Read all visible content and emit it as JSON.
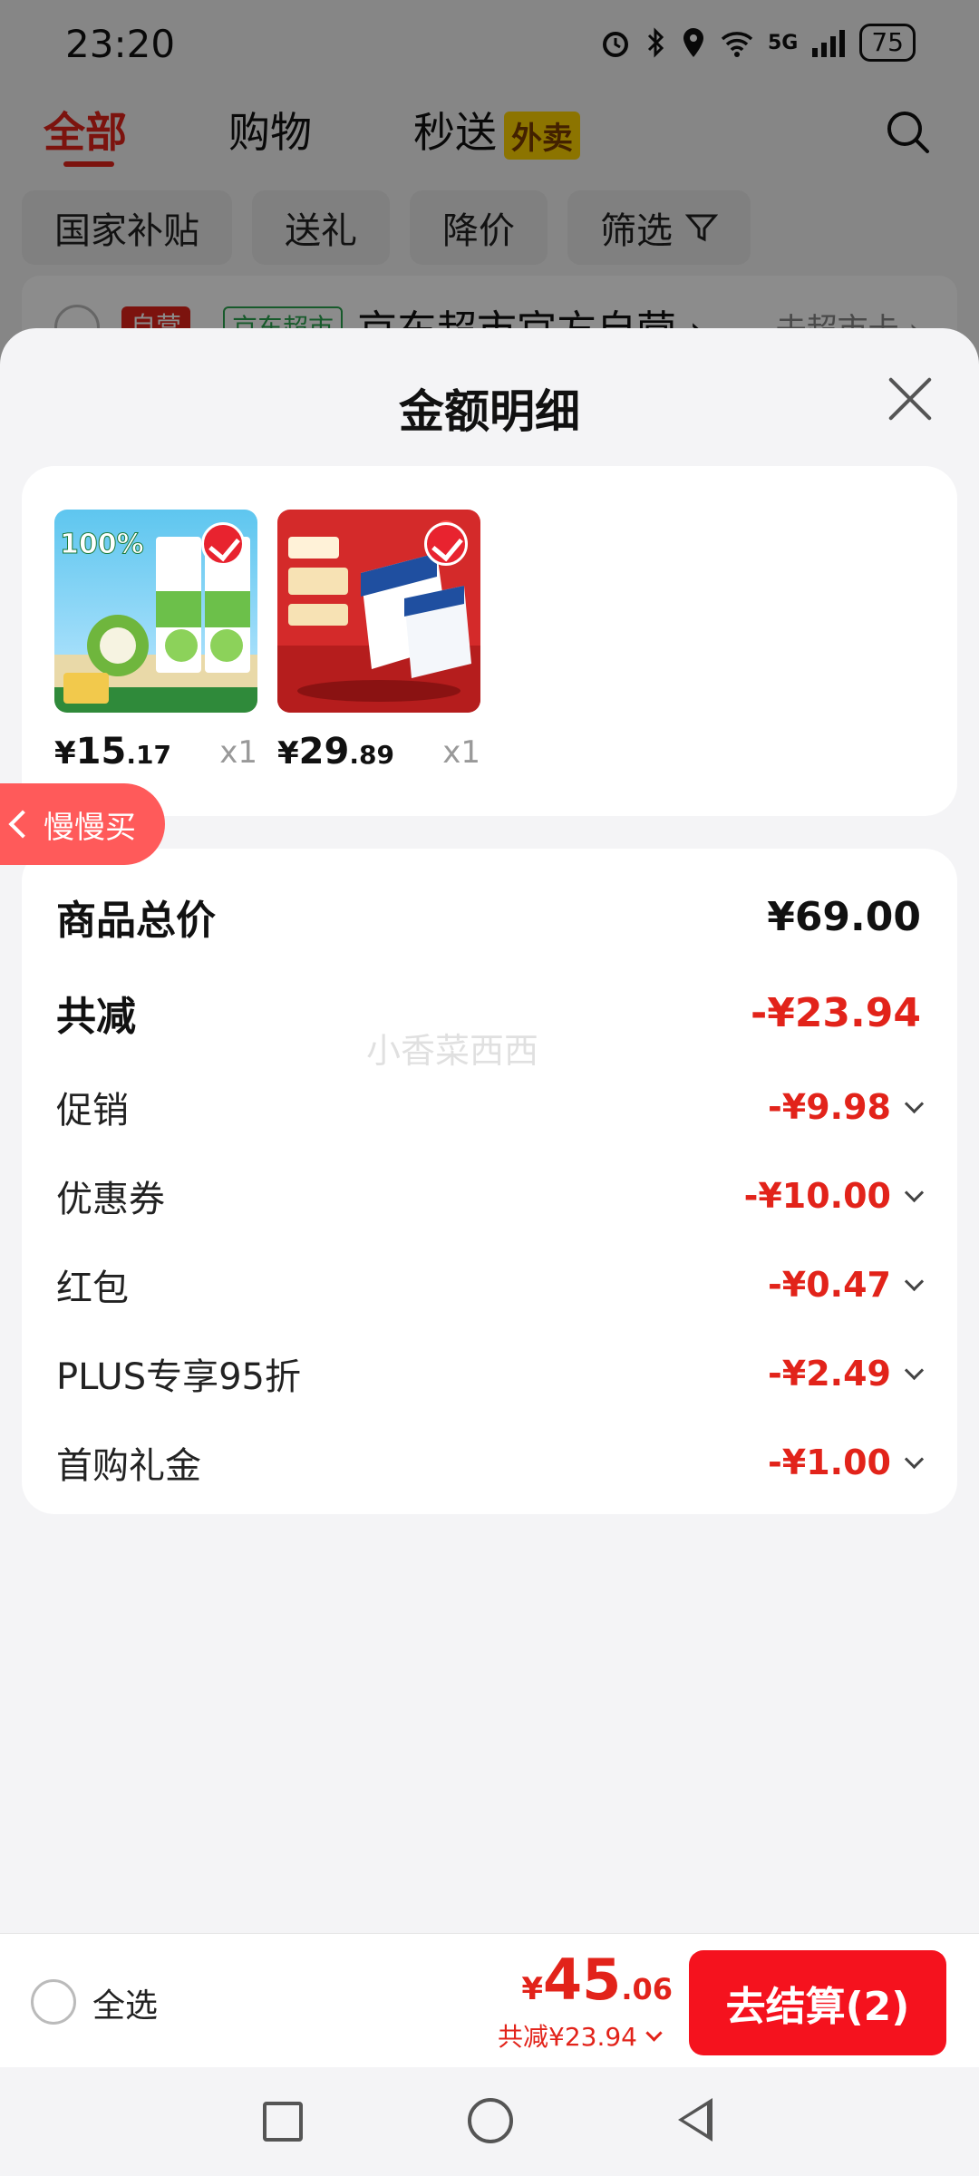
{
  "status_bar": {
    "time": "23:20",
    "battery": "75",
    "signal_label": "5G"
  },
  "tabs": [
    {
      "label": "全部",
      "active": true
    },
    {
      "label": "购物",
      "active": false
    },
    {
      "label": "秒送",
      "active": false,
      "badge": "外卖"
    }
  ],
  "filters": [
    "国家补贴",
    "送礼",
    "降价",
    "筛选"
  ],
  "store": {
    "tag_self": "自营",
    "tag_market": "京东超市",
    "name": "京东超市官方自营 ›",
    "link": "去超市卡 ›"
  },
  "sheet": {
    "title": "金额明细",
    "products": [
      {
        "image": "coconut-water-product",
        "price_yen": "¥",
        "price_int": "15",
        "price_dec": ".17",
        "qty": "x1",
        "selected": true
      },
      {
        "image": "pure-milk-gift-box",
        "price_yen": "¥",
        "price_int": "29",
        "price_dec": ".89",
        "qty": "x1",
        "selected": true
      }
    ],
    "slow_buy": "慢慢买",
    "watermark": "小香菜西西",
    "summary": {
      "total_label": "商品总价",
      "total_value": "¥69.00",
      "discount_label": "共减",
      "discount_value": "-¥23.94",
      "items": [
        {
          "label": "促销",
          "value": "-¥9.98"
        },
        {
          "label": "优惠券",
          "value": "-¥10.00"
        },
        {
          "label": "红包",
          "value": "-¥0.47"
        },
        {
          "label": "PLUS专享95折",
          "value": "-¥2.49"
        },
        {
          "label": "首购礼金",
          "value": "-¥1.00"
        }
      ]
    }
  },
  "bottom": {
    "select_all": "全选",
    "price_yen": "¥",
    "price_int": "45",
    "price_dec": ".06",
    "discount_text": "共减¥23.94",
    "checkout": "去结算(2)"
  },
  "colors": {
    "accent": "#e2231a",
    "checkout": "#f5121e",
    "slow_buy": "#ff5a5a"
  }
}
